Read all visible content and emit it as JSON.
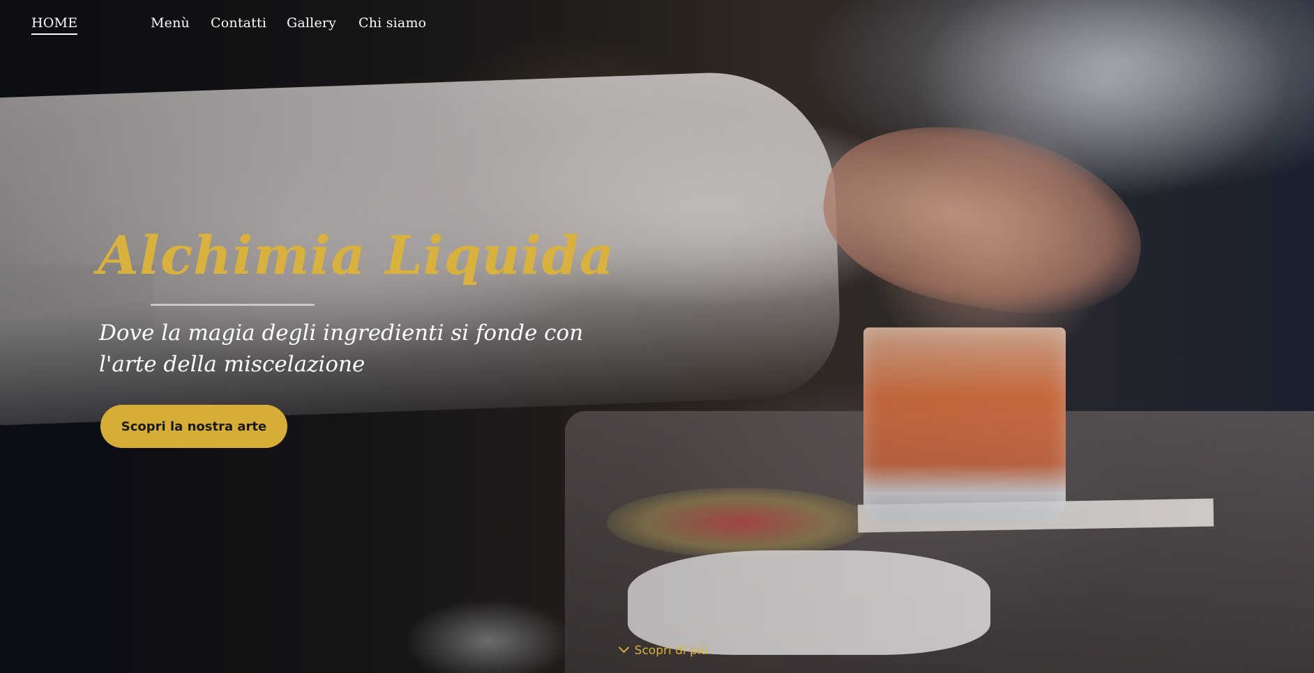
{
  "nav": {
    "items": [
      {
        "label": "HOME",
        "active": true
      },
      {
        "label": "Menù",
        "active": false
      },
      {
        "label": "Contatti",
        "active": false
      },
      {
        "label": "Gallery",
        "active": false
      },
      {
        "label": "Chi siamo",
        "active": false
      }
    ]
  },
  "hero": {
    "title": "Alchimia Liquida",
    "subtitle": "Dove la magia degli ingredienti si fonde con l'arte della miscelazione",
    "cta_label": "Scopri la nostra arte",
    "scroll_label": "Scopri di più"
  },
  "colors": {
    "accent": "#d5ad37",
    "title": "#d9b13e",
    "text": "#ffffff"
  },
  "icons": {
    "scroll": "chevron-down-icon"
  }
}
